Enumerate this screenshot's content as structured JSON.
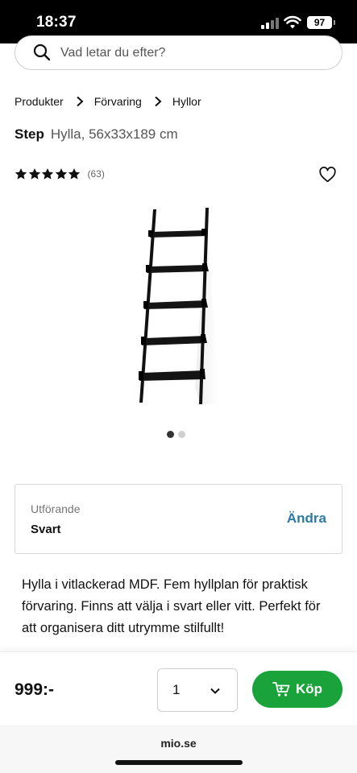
{
  "status_bar": {
    "time": "18:37",
    "battery": "97"
  },
  "search": {
    "placeholder": "Vad letar du efter?"
  },
  "breadcrumb": [
    "Produkter",
    "Förvaring",
    "Hyllor"
  ],
  "product": {
    "brand": "Step",
    "subtitle": "Hylla, 56x33x189 cm",
    "rating": {
      "stars": 5,
      "count": "(63)"
    },
    "image_count": 2,
    "active_image_index": 0
  },
  "variant": {
    "label": "Utförande",
    "value": "Svart",
    "change_label": "Ändra"
  },
  "description": "Hylla i vitlackerad MDF. Fem hyllplan för praktisk förvaring. Finns att välja i svart eller vitt. Perfekt för att organisera ditt utrymme stilfullt!",
  "buy_bar": {
    "price": "999:-",
    "quantity": "1",
    "buy_label": "Köp"
  },
  "browser": {
    "url": "mio.se"
  },
  "colors": {
    "buy_button": "#19a33a",
    "link": "#2b7aa5",
    "status_bar": "#000000"
  },
  "icons": {
    "search": "search-icon",
    "breadcrumb_separator": "chevron-right-icon",
    "star": "star-icon",
    "favorite": "heart-icon",
    "quantity": "chevron-down-icon",
    "buy": "cart-icon"
  }
}
